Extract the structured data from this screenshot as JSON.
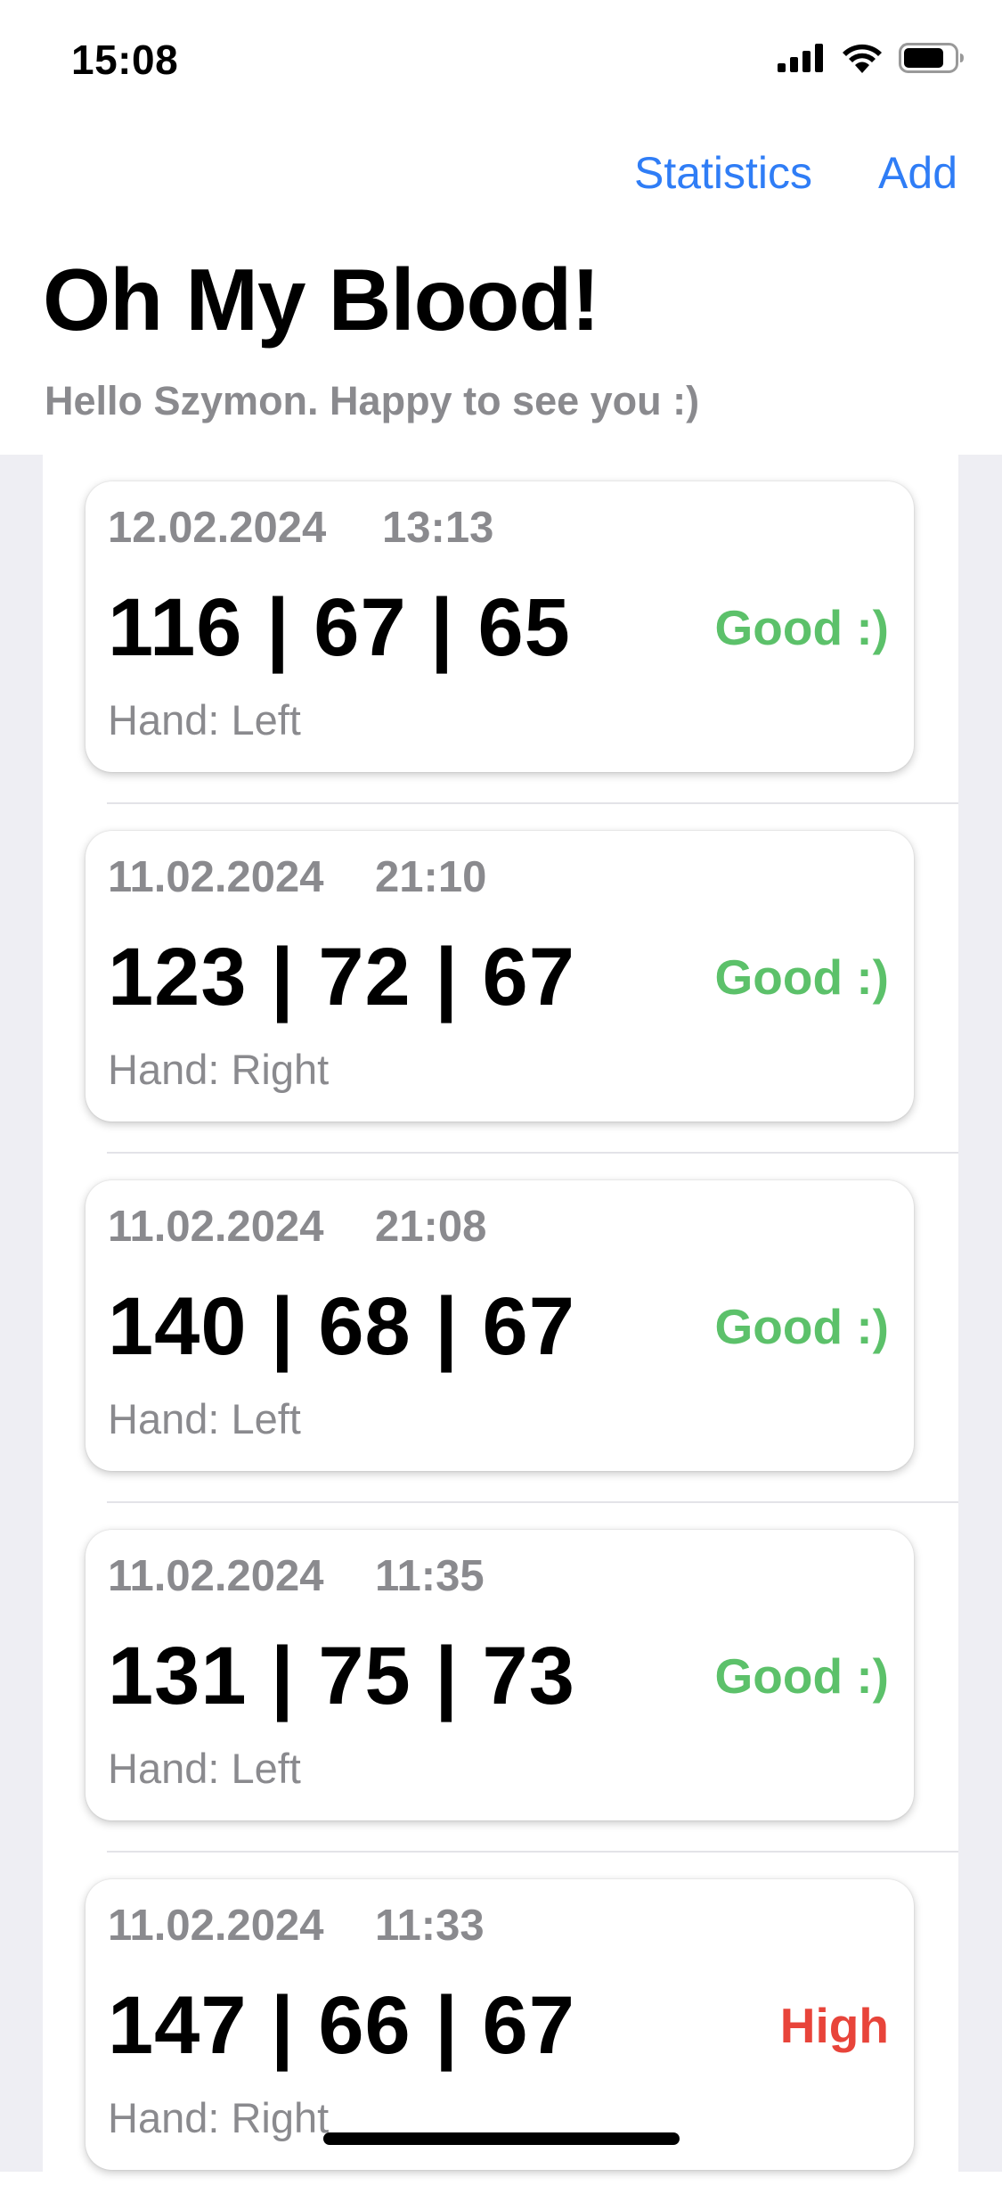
{
  "status_bar": {
    "time": "15:08"
  },
  "nav": {
    "statistics": "Statistics",
    "add": "Add"
  },
  "header": {
    "title": "Oh My Blood!",
    "subtitle": "Hello Szymon. Happy to see you :)"
  },
  "colors": {
    "accent": "#2f7df6",
    "good": "#5cc16a",
    "high": "#e8443a",
    "secondary_text": "#8a8a8e"
  },
  "measurements": [
    {
      "date": "12.02.2024",
      "time": "13:13",
      "values": "116 | 67 | 65",
      "status": "Good :)",
      "hand": "Hand: Left"
    },
    {
      "date": "11.02.2024",
      "time": "21:10",
      "values": "123 | 72 | 67",
      "status": "Good :)",
      "hand": "Hand: Right"
    },
    {
      "date": "11.02.2024",
      "time": "21:08",
      "values": "140 | 68 | 67",
      "status": "Good :)",
      "hand": "Hand: Left"
    },
    {
      "date": "11.02.2024",
      "time": "11:35",
      "values": "131 | 75 | 73",
      "status": "Good :)",
      "hand": "Hand: Left"
    },
    {
      "date": "11.02.2024",
      "time": "11:33",
      "values": "147 | 66 | 67",
      "status": "High",
      "hand": "Hand: Right"
    }
  ]
}
